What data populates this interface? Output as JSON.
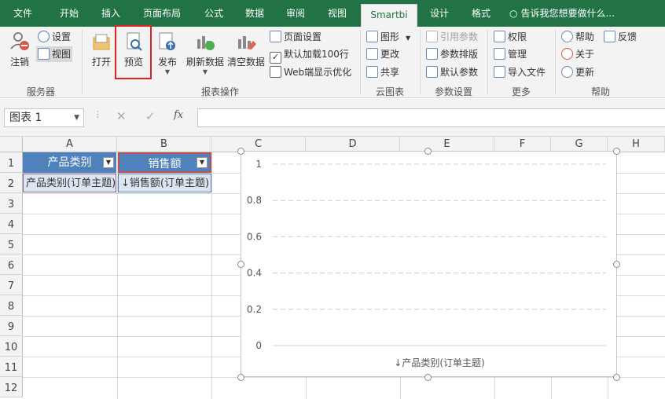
{
  "ribbon_tabs": [
    "文件",
    "开始",
    "插入",
    "页面布局",
    "公式",
    "数据",
    "审阅",
    "视图",
    "Smartbi",
    "设计",
    "格式"
  ],
  "active_tab": "Smartbi",
  "tell_me": "告诉我您想要做什么...",
  "groups": {
    "server": {
      "label": "服务器",
      "logout": "注销",
      "settings": "设置",
      "view": "视图"
    },
    "report_ops": {
      "label": "报表操作",
      "open": "打开",
      "preview": "预览",
      "publish": "发布",
      "refresh": "刷新数据",
      "clear": "清空数据",
      "page_setup": "页面设置",
      "default_load": "默认加载100行",
      "web_optimize": "Web端显示优化"
    },
    "cloud_chart": {
      "label": "云图表",
      "chart": "图形",
      "modify": "更改",
      "share": "共享"
    },
    "params": {
      "label": "参数设置",
      "ref_params": "引用参数",
      "param_layout": "参数排版",
      "default_params": "默认参数"
    },
    "more": {
      "label": "更多",
      "permissions": "权限",
      "manage": "管理",
      "import_file": "导入文件"
    },
    "help": {
      "label": "帮助",
      "help": "帮助",
      "feedback": "反馈",
      "about": "关于",
      "update": "更新"
    }
  },
  "formula_bar": {
    "name_box": "图表 1",
    "fx": "fx",
    "formula": ""
  },
  "sheet": {
    "columns": [
      "A",
      "B",
      "C",
      "D",
      "E",
      "F",
      "G",
      "H"
    ],
    "rows": [
      "1",
      "2",
      "3",
      "4",
      "5",
      "6",
      "7",
      "8",
      "9",
      "10",
      "11",
      "12"
    ],
    "header_cells": [
      "产品类别",
      "销售额"
    ],
    "field_cells": [
      "产品类别(订单主题)",
      "↓销售额(订单主题)"
    ]
  },
  "chart_data": {
    "type": "bar",
    "categories": [],
    "series": [],
    "yticks": [
      "0",
      "0.2",
      "0.4",
      "0.6",
      "0.8",
      "1"
    ],
    "ylim": [
      0,
      1
    ],
    "xlabel": "↓产品类别(订单主题)",
    "grid": true
  }
}
